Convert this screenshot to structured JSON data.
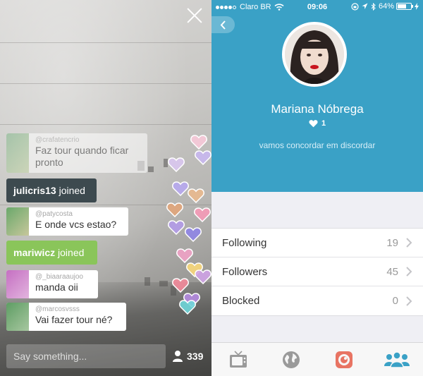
{
  "stream": {
    "say_placeholder": "Say something...",
    "viewer_count": "339",
    "messages": [
      {
        "type": "chat",
        "user": "@crafatencrio",
        "text_line1": "Faz tour quando ficar",
        "text_line2": "pronto",
        "faded": true
      },
      {
        "type": "join",
        "user": "julicris13",
        "suffix": " joined",
        "color": "#3d4a4f"
      },
      {
        "type": "chat",
        "user": "@patycosta",
        "text_line1": "E onde vcs estao?"
      },
      {
        "type": "join",
        "user": "mariwicz",
        "suffix": " joined",
        "color": "#8ac55a"
      },
      {
        "type": "chat",
        "user": "@_biaaraaujoo",
        "text_line1": "manda oii"
      },
      {
        "type": "chat",
        "user": "@marcosvsss",
        "text_line1": "Vai fazer tour né?"
      }
    ],
    "heart_colors": [
      "#f7c9d8",
      "#d9c7ef",
      "#c8b7f0",
      "#b7a8ee",
      "#e9b98e",
      "#e1a57a",
      "#f59ab7",
      "#8f85e6",
      "#b39be8",
      "#f0a2c5",
      "#f7d77b",
      "#cfa3e6",
      "#f28a9a",
      "#b58be0",
      "#6fd6d9"
    ]
  },
  "status_bar": {
    "carrier": "Claro BR",
    "time": "09:06",
    "battery": "64%",
    "battery_level": 0.64
  },
  "profile": {
    "name": "Mariana Nóbrega",
    "likes": "1",
    "bio": "vamos concordar em discordar",
    "accent_color": "#3aa1c6",
    "stats": [
      {
        "label": "Following",
        "value": "19"
      },
      {
        "label": "Followers",
        "value": "45"
      },
      {
        "label": "Blocked",
        "value": "0"
      }
    ]
  },
  "tabs": [
    {
      "icon": "tv-icon",
      "active": false
    },
    {
      "icon": "globe-icon",
      "active": false
    },
    {
      "icon": "periscope-icon",
      "active": false
    },
    {
      "icon": "people-icon",
      "active": true
    }
  ]
}
